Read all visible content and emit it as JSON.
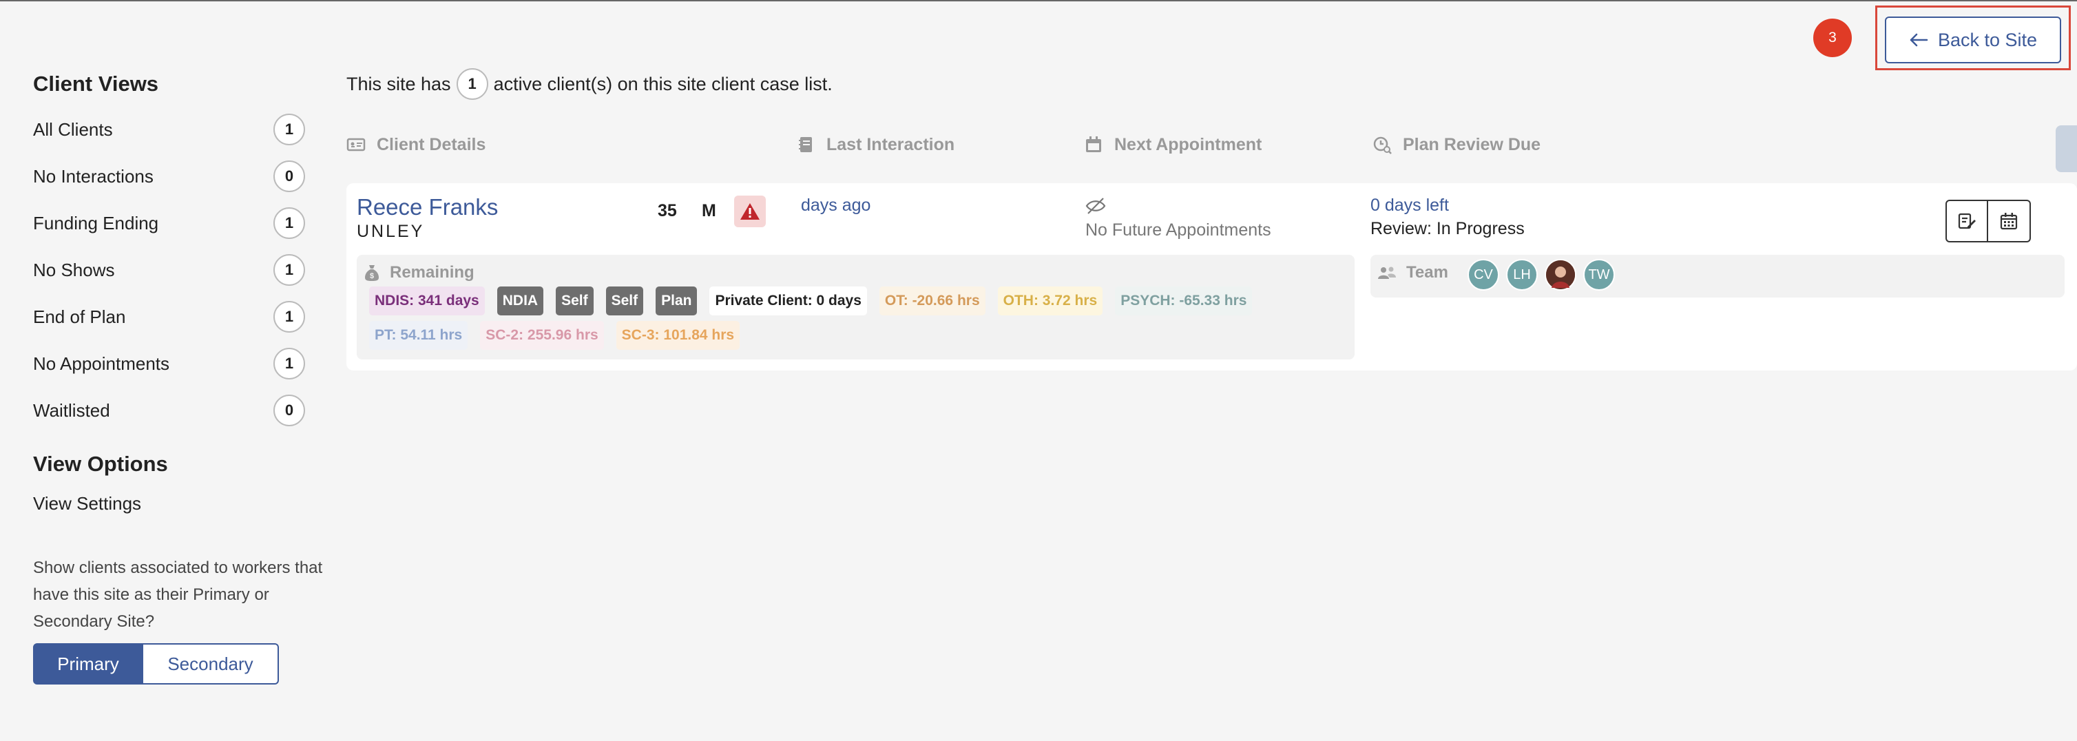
{
  "sidebar": {
    "title": "Client Views",
    "items": [
      {
        "label": "All Clients",
        "count": "1"
      },
      {
        "label": "No Interactions",
        "count": "0"
      },
      {
        "label": "Funding Ending",
        "count": "1"
      },
      {
        "label": "No Shows",
        "count": "1"
      },
      {
        "label": "End of Plan",
        "count": "1"
      },
      {
        "label": "No Appointments",
        "count": "1"
      },
      {
        "label": "Waitlisted",
        "count": "0"
      }
    ],
    "view_options_title": "View Options",
    "view_settings": "View Settings",
    "help_text": "Show clients associated to workers that have this site as their Primary or Secondary Site?",
    "toggle": {
      "primary": "Primary",
      "secondary": "Secondary",
      "selected": "Primary"
    }
  },
  "header": {
    "notification_count": "3",
    "back_button": "Back to Site",
    "summary_prefix": "This site has",
    "summary_count": "1",
    "summary_suffix": "active client(s) on this site client case list."
  },
  "columns": [
    "Client Details",
    "Last Interaction",
    "Next Appointment",
    "Plan Review Due"
  ],
  "client": {
    "name": "Reece Franks",
    "suburb": "UNLEY",
    "age": "35",
    "gender": "M",
    "last_interaction": "days ago",
    "next_appointment": "No Future Appointments",
    "plan_review_due": "0 days left",
    "review_status": "Review: In Progress",
    "remaining_label": "Remaining",
    "team_label": "Team",
    "funding_tags": [
      {
        "text": "NDIS: 341 days",
        "bg": "#f1e2f0",
        "color": "#7a2f7a"
      },
      {
        "text": "NDIA",
        "bg": "#6e6e6e",
        "color": "#ffffff"
      },
      {
        "text": "Self",
        "bg": "#6e6e6e",
        "color": "#ffffff"
      },
      {
        "text": "Self",
        "bg": "#6e6e6e",
        "color": "#ffffff"
      },
      {
        "text": "Plan",
        "bg": "#6e6e6e",
        "color": "#ffffff"
      },
      {
        "text": "Private Client: 0 days",
        "bg": "#ffffff",
        "color": "#222222"
      },
      {
        "text": "OT: -20.66 hrs",
        "bg": "#fbf3e6",
        "color": "#d49a5a"
      },
      {
        "text": "OTH: 3.72 hrs",
        "bg": "#fdf6e0",
        "color": "#d8b048"
      },
      {
        "text": "PSYCH: -65.33 hrs",
        "bg": "#eef3f2",
        "color": "#7fa0a0"
      },
      {
        "text": "PT: 54.11 hrs",
        "bg": "#eef1f7",
        "color": "#8da4cc"
      },
      {
        "text": "SC-2: 255.96 hrs",
        "bg": "#f9eef1",
        "color": "#d898a8"
      },
      {
        "text": "SC-3: 101.84 hrs",
        "bg": "#fcf0e2",
        "color": "#e6a55c"
      }
    ],
    "team": [
      "CV",
      "LH",
      "",
      "TW"
    ]
  },
  "colors": {
    "accent": "#3d5a99",
    "badge": "#e03b26",
    "highlight": "#d9483b"
  }
}
